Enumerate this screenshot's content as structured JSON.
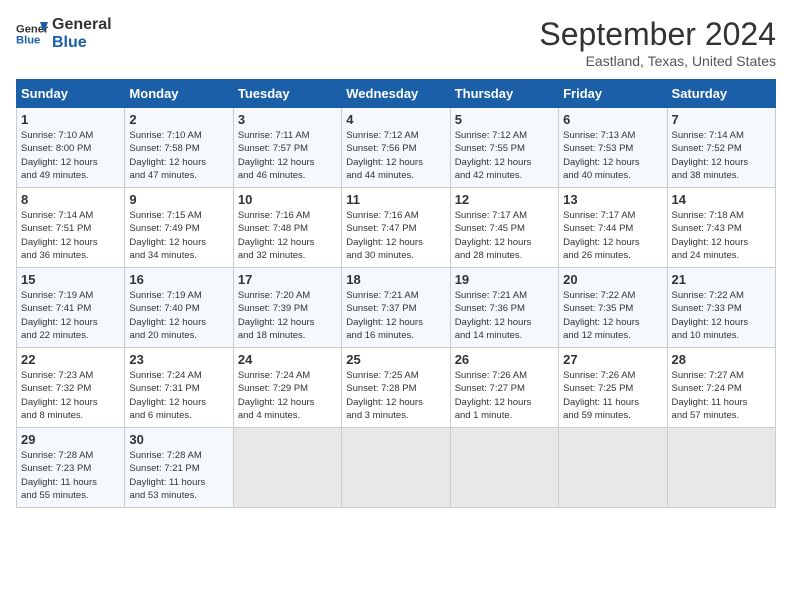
{
  "logo": {
    "line1": "General",
    "line2": "Blue"
  },
  "title": "September 2024",
  "location": "Eastland, Texas, United States",
  "days_of_week": [
    "Sunday",
    "Monday",
    "Tuesday",
    "Wednesday",
    "Thursday",
    "Friday",
    "Saturday"
  ],
  "weeks": [
    [
      {
        "day": "1",
        "info": "Sunrise: 7:10 AM\nSunset: 8:00 PM\nDaylight: 12 hours\nand 49 minutes."
      },
      {
        "day": "2",
        "info": "Sunrise: 7:10 AM\nSunset: 7:58 PM\nDaylight: 12 hours\nand 47 minutes."
      },
      {
        "day": "3",
        "info": "Sunrise: 7:11 AM\nSunset: 7:57 PM\nDaylight: 12 hours\nand 46 minutes."
      },
      {
        "day": "4",
        "info": "Sunrise: 7:12 AM\nSunset: 7:56 PM\nDaylight: 12 hours\nand 44 minutes."
      },
      {
        "day": "5",
        "info": "Sunrise: 7:12 AM\nSunset: 7:55 PM\nDaylight: 12 hours\nand 42 minutes."
      },
      {
        "day": "6",
        "info": "Sunrise: 7:13 AM\nSunset: 7:53 PM\nDaylight: 12 hours\nand 40 minutes."
      },
      {
        "day": "7",
        "info": "Sunrise: 7:14 AM\nSunset: 7:52 PM\nDaylight: 12 hours\nand 38 minutes."
      }
    ],
    [
      {
        "day": "8",
        "info": "Sunrise: 7:14 AM\nSunset: 7:51 PM\nDaylight: 12 hours\nand 36 minutes."
      },
      {
        "day": "9",
        "info": "Sunrise: 7:15 AM\nSunset: 7:49 PM\nDaylight: 12 hours\nand 34 minutes."
      },
      {
        "day": "10",
        "info": "Sunrise: 7:16 AM\nSunset: 7:48 PM\nDaylight: 12 hours\nand 32 minutes."
      },
      {
        "day": "11",
        "info": "Sunrise: 7:16 AM\nSunset: 7:47 PM\nDaylight: 12 hours\nand 30 minutes."
      },
      {
        "day": "12",
        "info": "Sunrise: 7:17 AM\nSunset: 7:45 PM\nDaylight: 12 hours\nand 28 minutes."
      },
      {
        "day": "13",
        "info": "Sunrise: 7:17 AM\nSunset: 7:44 PM\nDaylight: 12 hours\nand 26 minutes."
      },
      {
        "day": "14",
        "info": "Sunrise: 7:18 AM\nSunset: 7:43 PM\nDaylight: 12 hours\nand 24 minutes."
      }
    ],
    [
      {
        "day": "15",
        "info": "Sunrise: 7:19 AM\nSunset: 7:41 PM\nDaylight: 12 hours\nand 22 minutes."
      },
      {
        "day": "16",
        "info": "Sunrise: 7:19 AM\nSunset: 7:40 PM\nDaylight: 12 hours\nand 20 minutes."
      },
      {
        "day": "17",
        "info": "Sunrise: 7:20 AM\nSunset: 7:39 PM\nDaylight: 12 hours\nand 18 minutes."
      },
      {
        "day": "18",
        "info": "Sunrise: 7:21 AM\nSunset: 7:37 PM\nDaylight: 12 hours\nand 16 minutes."
      },
      {
        "day": "19",
        "info": "Sunrise: 7:21 AM\nSunset: 7:36 PM\nDaylight: 12 hours\nand 14 minutes."
      },
      {
        "day": "20",
        "info": "Sunrise: 7:22 AM\nSunset: 7:35 PM\nDaylight: 12 hours\nand 12 minutes."
      },
      {
        "day": "21",
        "info": "Sunrise: 7:22 AM\nSunset: 7:33 PM\nDaylight: 12 hours\nand 10 minutes."
      }
    ],
    [
      {
        "day": "22",
        "info": "Sunrise: 7:23 AM\nSunset: 7:32 PM\nDaylight: 12 hours\nand 8 minutes."
      },
      {
        "day": "23",
        "info": "Sunrise: 7:24 AM\nSunset: 7:31 PM\nDaylight: 12 hours\nand 6 minutes."
      },
      {
        "day": "24",
        "info": "Sunrise: 7:24 AM\nSunset: 7:29 PM\nDaylight: 12 hours\nand 4 minutes."
      },
      {
        "day": "25",
        "info": "Sunrise: 7:25 AM\nSunset: 7:28 PM\nDaylight: 12 hours\nand 3 minutes."
      },
      {
        "day": "26",
        "info": "Sunrise: 7:26 AM\nSunset: 7:27 PM\nDaylight: 12 hours\nand 1 minute."
      },
      {
        "day": "27",
        "info": "Sunrise: 7:26 AM\nSunset: 7:25 PM\nDaylight: 11 hours\nand 59 minutes."
      },
      {
        "day": "28",
        "info": "Sunrise: 7:27 AM\nSunset: 7:24 PM\nDaylight: 11 hours\nand 57 minutes."
      }
    ],
    [
      {
        "day": "29",
        "info": "Sunrise: 7:28 AM\nSunset: 7:23 PM\nDaylight: 11 hours\nand 55 minutes."
      },
      {
        "day": "30",
        "info": "Sunrise: 7:28 AM\nSunset: 7:21 PM\nDaylight: 11 hours\nand 53 minutes."
      },
      {
        "day": "",
        "info": ""
      },
      {
        "day": "",
        "info": ""
      },
      {
        "day": "",
        "info": ""
      },
      {
        "day": "",
        "info": ""
      },
      {
        "day": "",
        "info": ""
      }
    ]
  ]
}
